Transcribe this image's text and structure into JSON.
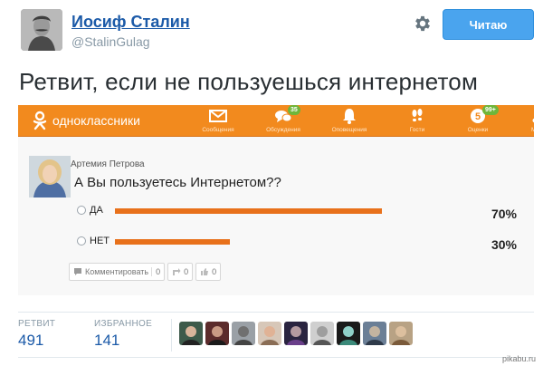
{
  "tweet": {
    "author_name": "Иосиф Сталин",
    "author_handle": "@StalinGulag",
    "follow_label": "Читаю",
    "text": "Ретвит, если не пользуешься интернетом"
  },
  "odnoklassniki": {
    "brand": "однoклассники",
    "accent_color": "#f28a1e",
    "nav": [
      {
        "label": "Сообщения",
        "icon": "envelope-icon",
        "badge": ""
      },
      {
        "label": "Обсуждения",
        "icon": "chat-bubbles-icon",
        "badge": "35"
      },
      {
        "label": "Оповещения",
        "icon": "bell-icon",
        "badge": ""
      },
      {
        "label": "Гости",
        "icon": "footprints-icon",
        "badge": ""
      },
      {
        "label": "Оценки",
        "icon": "rating-icon",
        "badge": "99+"
      },
      {
        "label": "Му",
        "icon": "music-icon",
        "badge": ""
      }
    ],
    "post": {
      "author": "Артемия Петрова",
      "question": "А Вы пользуетесь Интернетом??",
      "options": [
        {
          "label": "ДА",
          "percent_text": "70%",
          "fraction": 0.7
        },
        {
          "label": "НЕТ",
          "percent_text": "30%",
          "fraction": 0.3
        }
      ],
      "actions": {
        "comment_label": "Комментировать",
        "comment_count": "0",
        "share_count": "0",
        "like_count": "0"
      }
    }
  },
  "stats": {
    "retweets_label": "РЕТВИТ",
    "retweets_value": "491",
    "favorites_label": "ИЗБРАННОЕ",
    "favorites_value": "141"
  },
  "watermark": "pikabu.ru"
}
